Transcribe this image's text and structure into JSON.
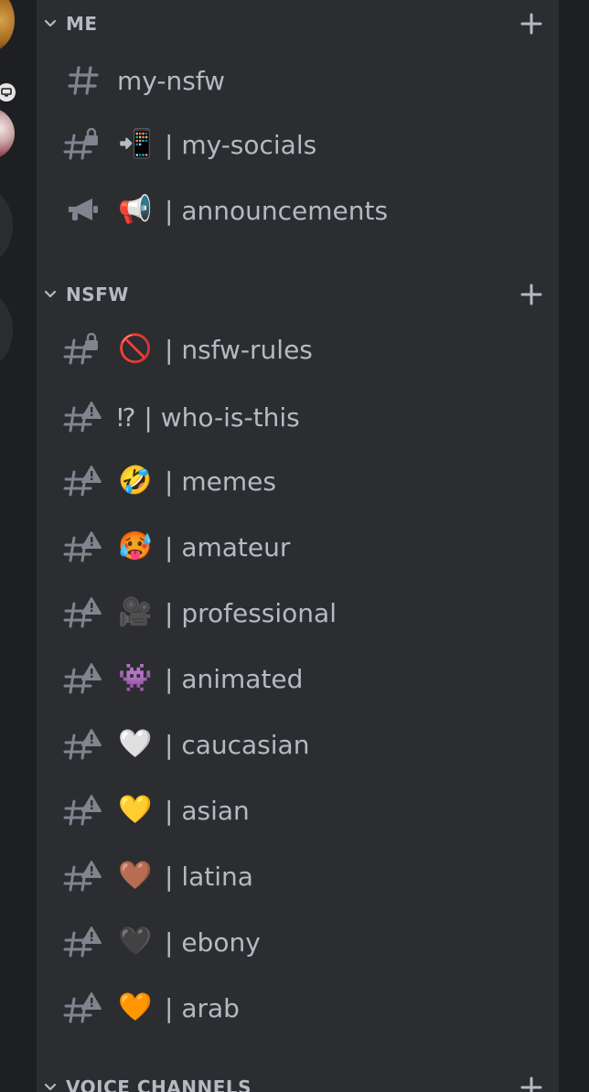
{
  "categories": [
    {
      "name": "ME",
      "add_label": "+"
    },
    {
      "name": "NSFW",
      "add_label": "+"
    },
    {
      "name": "VOICE CHANNELS",
      "add_label": "+"
    }
  ],
  "channels": [
    {
      "icon": "hashtag-icon",
      "emoji": "",
      "name": "my-nsfw"
    },
    {
      "icon": "locked-hashtag-icon",
      "emoji": "📲",
      "name": "| my-socials"
    },
    {
      "icon": "megaphone-icon",
      "emoji": "📢",
      "name": "| announcements"
    },
    {
      "icon": "locked-hashtag-icon",
      "emoji": "🚫",
      "name": "| nsfw-rules"
    },
    {
      "icon": "nsfw-hashtag-icon",
      "emoji": "",
      "name": "⁉ | who-is-this"
    },
    {
      "icon": "nsfw-hashtag-icon",
      "emoji": "🤣",
      "name": "| memes"
    },
    {
      "icon": "nsfw-hashtag-icon",
      "emoji": "🥵",
      "name": "| amateur"
    },
    {
      "icon": "nsfw-hashtag-icon",
      "emoji": "🎥",
      "name": "| professional"
    },
    {
      "icon": "nsfw-hashtag-icon",
      "emoji": "👾",
      "name": "| animated"
    },
    {
      "icon": "nsfw-hashtag-icon",
      "emoji": "🤍",
      "name": "| caucasian"
    },
    {
      "icon": "nsfw-hashtag-icon",
      "emoji": "💛",
      "name": "| asian"
    },
    {
      "icon": "nsfw-hashtag-icon",
      "emoji": "🤎",
      "name": "| latina"
    },
    {
      "icon": "nsfw-hashtag-icon",
      "emoji": "🖤",
      "name": "| ebony"
    },
    {
      "icon": "nsfw-hashtag-icon",
      "emoji": "🧡",
      "name": "| arab"
    }
  ],
  "colors": {
    "panel_bg": "#2b2d31",
    "rail_bg": "#1e1f22",
    "text_muted": "#b5bac1",
    "icon_muted": "#80848e"
  }
}
